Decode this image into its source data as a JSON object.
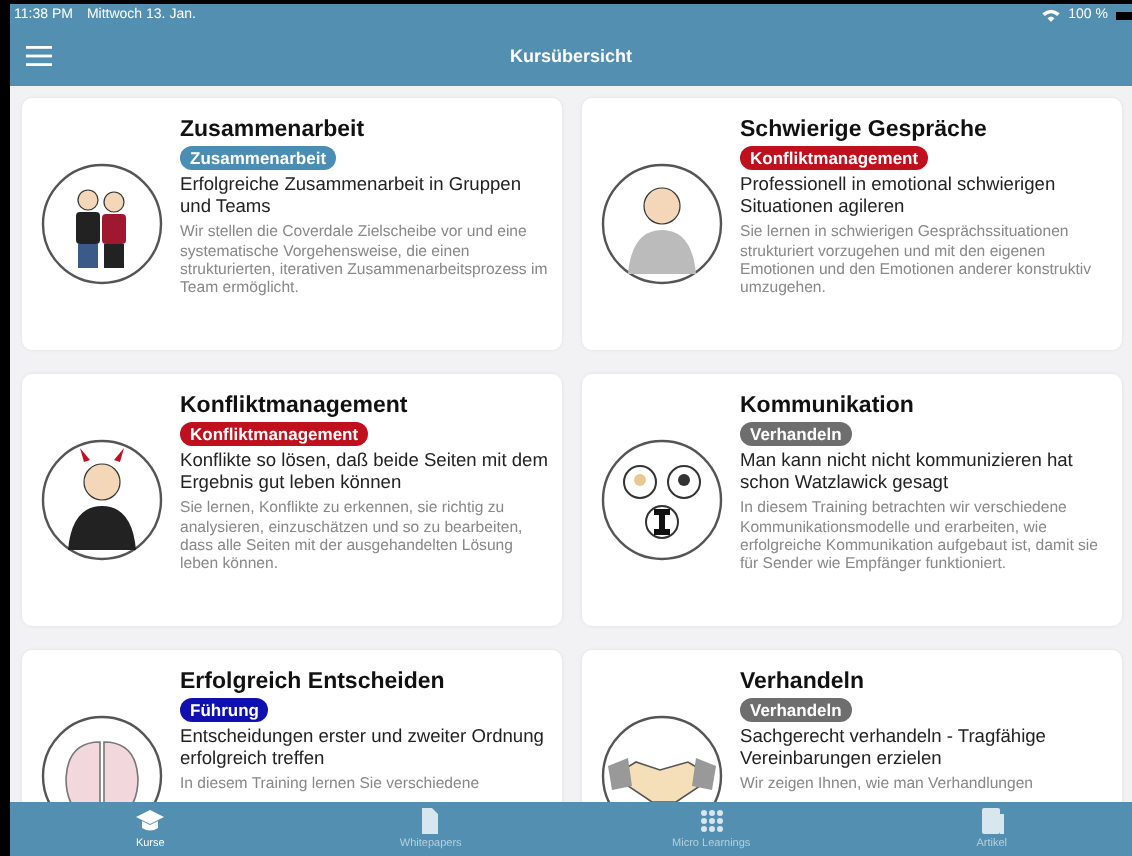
{
  "status_bar": {
    "time": "11:38 PM",
    "date": "Mittwoch 13. Jan.",
    "battery": "100 %"
  },
  "header": {
    "title": "Kursübersicht"
  },
  "courses": [
    {
      "title": "Zusammenarbeit",
      "tag": {
        "label": "Zusammenarbeit",
        "color": "#4a8db5"
      },
      "subtitle": "Erfolgreiche Zusammenarbeit in Gruppen und Teams",
      "description": "Wir stellen die Coverdale Zielscheibe vor und eine systematische Vorgehensweise, die einen strukturierten, iterativen Zusammenarbeitsprozess im Team ermöglicht."
    },
    {
      "title": "Schwierige Gespräche",
      "tag": {
        "label": "Konfliktmanagement",
        "color": "#c0101e"
      },
      "subtitle": "Professionell in emotional schwierigen Situationen agileren",
      "description": "Sie lernen in schwierigen Gesprächssituationen strukturiert vorzugehen und mit den eigenen Emotionen und den Emotionen anderer konstruktiv umzugehen."
    },
    {
      "title": "Konfliktmanagement",
      "tag": {
        "label": "Konfliktmanagement",
        "color": "#c0101e"
      },
      "subtitle": "Konflikte so lösen, daß beide Seiten mit dem Ergebnis gut leben können",
      "description": "Sie lernen, Konflikte zu erkennen, sie richtig zu analysieren, einzuschätzen und so zu bearbeiten, dass alle Seiten mit der ausgehandelten Lösung leben können."
    },
    {
      "title": "Kommunikation",
      "tag": {
        "label": "Verhandeln",
        "color": "#6e6e6e"
      },
      "subtitle": "Man kann nicht nicht kommunizieren hat schon Watzlawick gesagt",
      "description": "In diesem Training betrachten wir verschiedene Kommunikationsmodelle und erarbeiten, wie erfolgreiche Kommunikation aufgebaut ist, damit sie für Sender wie Empfänger funktioniert."
    },
    {
      "title": "Erfolgreich Entscheiden",
      "tag": {
        "label": "Führung",
        "color": "#1010b0"
      },
      "subtitle": "Entscheidungen erster und zweiter Ordnung erfolgreich treffen",
      "description": "In diesem Training lernen Sie verschiedene"
    },
    {
      "title": "Verhandeln",
      "tag": {
        "label": "Verhandeln",
        "color": "#6e6e6e"
      },
      "subtitle": "Sachgerecht verhandeln - Tragfähige Vereinbarungen erzielen",
      "description": "Wir zeigen Ihnen, wie man Verhandlungen"
    }
  ],
  "tab_bar": [
    {
      "label": "Kurse",
      "selected": true
    },
    {
      "label": "Whitepapers",
      "selected": false
    },
    {
      "label": "Micro Learnings",
      "selected": false
    },
    {
      "label": "Artikel",
      "selected": false
    }
  ]
}
